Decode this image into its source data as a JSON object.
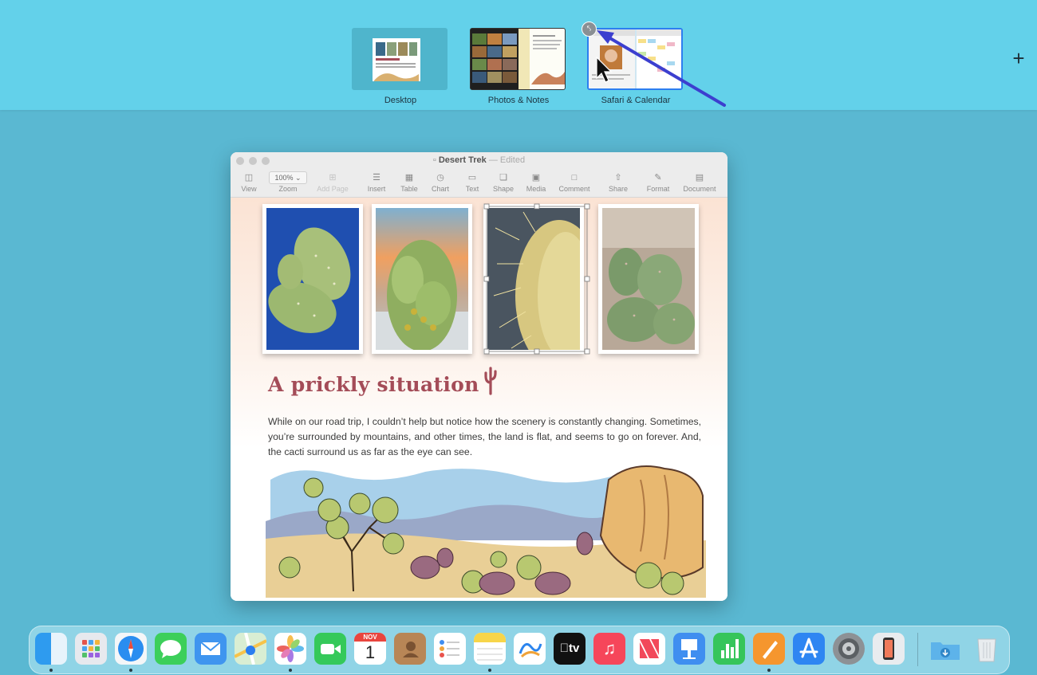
{
  "spaces": {
    "items": [
      {
        "label": "Desktop"
      },
      {
        "label": "Photos & Notes"
      },
      {
        "label": "Safari & Calendar"
      }
    ],
    "add_label": "+",
    "exit_full_screen_icon": "arrows-in-icon"
  },
  "window": {
    "title": "Desert Trek",
    "separator": " — ",
    "status": "Edited",
    "toolbar": {
      "view": "View",
      "zoom_value": "100%",
      "zoom": "Zoom",
      "add_page": "Add Page",
      "insert": "Insert",
      "table": "Table",
      "chart": "Chart",
      "text": "Text",
      "shape": "Shape",
      "media": "Media",
      "comment": "Comment",
      "share": "Share",
      "format": "Format",
      "document": "Document"
    }
  },
  "document": {
    "heading": "A prickly situation",
    "body": "While on our road trip, I couldn’t help but notice how the scenery is constantly changing. Sometimes, you’re surrounded by mountains, and other times, the land is flat, and seems to go on forever. And, the cacti surround us as far as the eye can see."
  },
  "dock": {
    "items": [
      "Finder",
      "Launchpad",
      "Safari",
      "Messages",
      "Mail",
      "Maps",
      "Photos",
      "FaceTime",
      "Calendar",
      "Contacts",
      "Reminders",
      "Notes",
      "Freeform",
      "TV",
      "Music",
      "News",
      "Keynote",
      "Numbers",
      "Pages",
      "App Store",
      "System Settings",
      "iPhone Mirroring",
      "Downloads",
      "Trash"
    ],
    "calendar_month": "NOV",
    "calendar_day": "1",
    "tv_label": "tv"
  },
  "colors": {
    "spaces_bar": "#63d1ea",
    "desktop": "#5ab8d2",
    "heading": "#a44c58",
    "selection": "#2d7ef0",
    "annotation_arrow": "#3c3fcf"
  }
}
